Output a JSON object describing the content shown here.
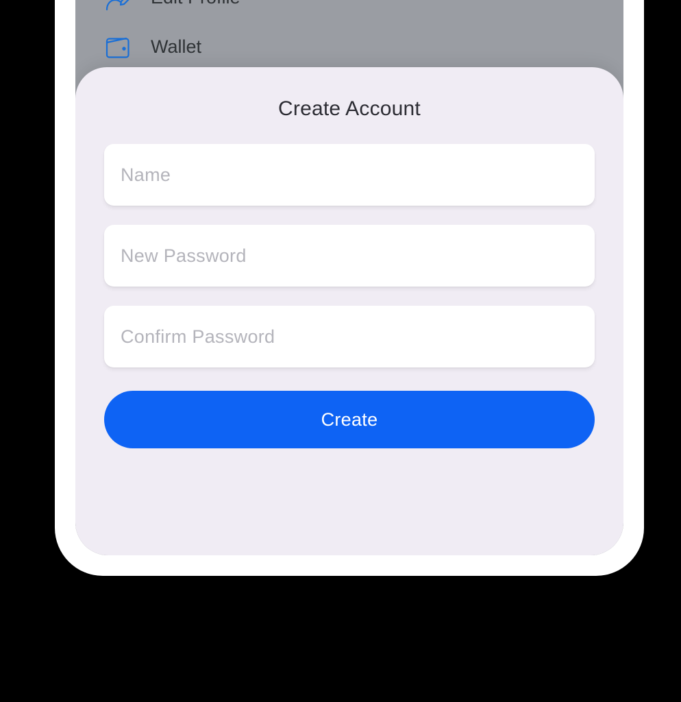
{
  "menu": {
    "items": [
      {
        "label": "Edit Profile"
      },
      {
        "label": "Wallet"
      }
    ]
  },
  "sheet": {
    "title": "Create Account",
    "fields": {
      "name_placeholder": "Name",
      "new_password_placeholder": "New Password",
      "confirm_password_placeholder": "Confirm Password"
    },
    "create_button": "Create"
  },
  "colors": {
    "accent": "#0e63f4",
    "icon": "#1a6fd6"
  }
}
